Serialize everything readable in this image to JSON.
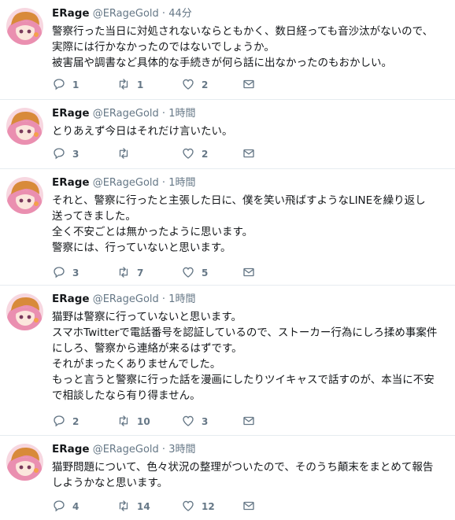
{
  "colors": {
    "text": "#14171a",
    "secondary": "#657786",
    "divider": "#e6ecf0"
  },
  "tweets": [
    {
      "name": "ERage",
      "handle": "@ERageGold",
      "dot": "·",
      "time": "44分",
      "text": "警察行った当日に対処されないならともかく、数日経っても音沙汰がないので、\n実際には行かなかったのではないでしょうか。\n被害届や調書など具体的な手続きが何ら話に出なかったのもおかしい。",
      "replies": "1",
      "retweets": "1",
      "likes": "2",
      "icons": [
        "reply-icon",
        "retweet-icon",
        "like-icon",
        "dm-icon"
      ]
    },
    {
      "name": "ERage",
      "handle": "@ERageGold",
      "dot": "·",
      "time": "1時間",
      "text": "とりあえず今日はそれだけ言いたい。",
      "replies": "3",
      "retweets": "",
      "likes": "2",
      "icons": [
        "reply-icon",
        "retweet-icon",
        "like-icon",
        "dm-icon"
      ]
    },
    {
      "name": "ERage",
      "handle": "@ERageGold",
      "dot": "·",
      "time": "1時間",
      "text": "それと、警察に行ったと主張した日に、僕を笑い飛ばすようなLINEを繰り返し\n送ってきました。\n全く不安ごとは無かったように思います。\n警察には、行っていないと思います。",
      "replies": "3",
      "retweets": "7",
      "likes": "5",
      "icons": [
        "reply-icon",
        "retweet-icon",
        "like-icon",
        "dm-icon"
      ]
    },
    {
      "name": "ERage",
      "handle": "@ERageGold",
      "dot": "·",
      "time": "1時間",
      "text": "猫野は警察に行っていないと思います。\nスマホTwitterで電話番号を認証しているので、ストーカー行為にしろ揉め事案件\nにしろ、警察から連絡が来るはずです。\nそれがまったくありませんでした。\nもっと言うと警察に行った話を漫画にしたりツイキャスで話すのが、本当に不安\nで相談したなら有り得ません。",
      "replies": "2",
      "retweets": "10",
      "likes": "3",
      "icons": [
        "reply-icon",
        "retweet-icon",
        "like-icon",
        "dm-icon"
      ]
    },
    {
      "name": "ERage",
      "handle": "@ERageGold",
      "dot": "·",
      "time": "3時間",
      "text": "猫野問題について、色々状況の整理がついたので、そのうち顛末をまとめて報告\nしようかなと思います。",
      "replies": "4",
      "retweets": "14",
      "likes": "12",
      "icons": [
        "reply-icon",
        "retweet-icon",
        "like-icon",
        "dm-icon"
      ]
    }
  ]
}
